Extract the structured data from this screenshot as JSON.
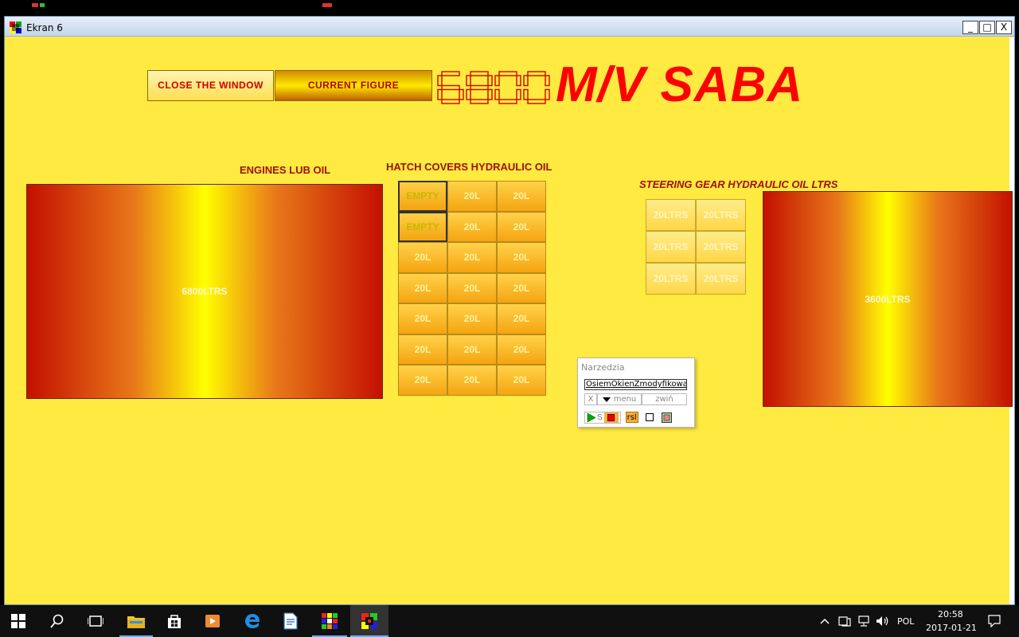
{
  "window": {
    "title": "Ekran 6",
    "minimize": "_",
    "maximize": "□",
    "close": "X"
  },
  "header": {
    "close_label": "CLOSE THE WINDOW",
    "current_label": "CURRENT FIGURE",
    "display_value": "6800",
    "ship_name": "M/V SABA"
  },
  "engines": {
    "label": "ENGINES LUB OIL",
    "value": "6800LTRS"
  },
  "hatch": {
    "label": "HATCH COVERS HYDRAULIC  OIL",
    "cells": [
      "EMPTY",
      "20L",
      "20L",
      "EMPTY",
      "20L",
      "20L",
      "20L",
      "20L",
      "20L",
      "20L",
      "20L",
      "20L",
      "20L",
      "20L",
      "20L",
      "20L",
      "20L",
      "20L",
      "20L",
      "20L",
      "20L"
    ]
  },
  "steering": {
    "label": "STEERING GEAR HYDRAULIC OIL   LTRS",
    "cells": [
      "20LTRS",
      "20LTRS",
      "20LTRS",
      "20LTRS",
      "20LTRS",
      "20LTRS"
    ],
    "tank_value": "3600LTRS"
  },
  "tools": {
    "title": "Narzedzia",
    "input_value": "OsiemOkienZmodyfikowan",
    "x_label": "X",
    "menu_label": "menu",
    "collapse_label": "zwiń",
    "s_label": "S",
    "rsl_label": "rsl"
  },
  "taskbar": {
    "language": "POL",
    "time": "20:58",
    "date": "2017-01-21"
  },
  "colors": {
    "background": "#ffea41",
    "title_red": "#ff0000",
    "label_red": "#a01010"
  }
}
